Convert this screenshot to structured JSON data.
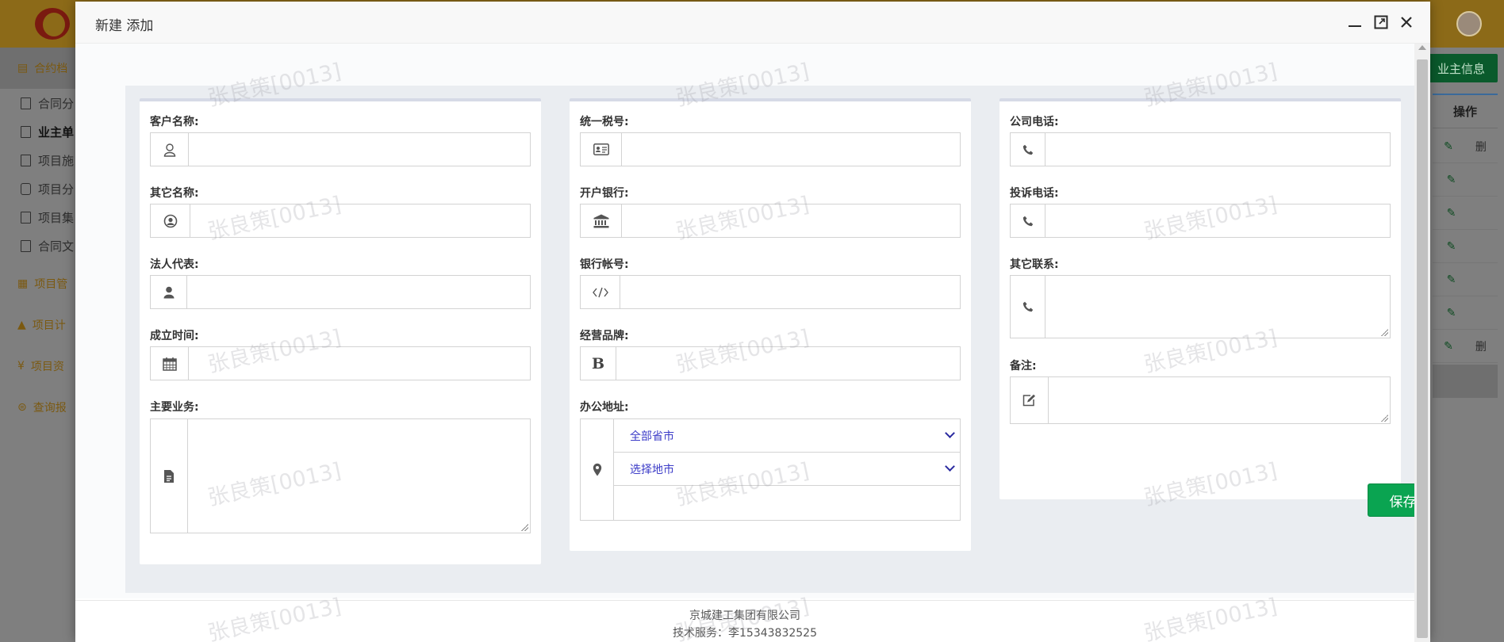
{
  "background": {
    "sidebar": {
      "groups": [
        "合约档",
        "项目管",
        "项目计",
        "项目资",
        "查询报"
      ],
      "items": [
        "合同分",
        "业主单",
        "项目施",
        "项目分",
        "项目集",
        "合同文"
      ]
    },
    "owner_button": "业主信息",
    "table": {
      "column": "操作",
      "row_actions": [
        "删",
        "",
        "",
        "",
        "",
        "",
        "删"
      ]
    }
  },
  "modal": {
    "title": "新建 添加",
    "fields": {
      "customer_name": {
        "label": "客户名称:",
        "value": ""
      },
      "other_name": {
        "label": "其它名称:",
        "value": ""
      },
      "legal_rep": {
        "label": "法人代表:",
        "value": ""
      },
      "established": {
        "label": "成立时间:",
        "value": ""
      },
      "main_business": {
        "label": "主要业务:",
        "value": ""
      },
      "tax_id": {
        "label": "统一税号:",
        "value": ""
      },
      "bank": {
        "label": "开户银行:",
        "value": ""
      },
      "bank_account": {
        "label": "银行帐号:",
        "value": ""
      },
      "brand": {
        "label": "经营品牌:",
        "value": ""
      },
      "office_address": {
        "label": "办公地址:",
        "province": "全部省市",
        "city": "选择地市",
        "detail": ""
      },
      "company_phone": {
        "label": "公司电话:",
        "value": ""
      },
      "complaint_phone": {
        "label": "投诉电话:",
        "value": ""
      },
      "other_contact": {
        "label": "其它联系:",
        "value": ""
      },
      "remark": {
        "label": "备注:",
        "value": ""
      }
    },
    "save_label": "保存添加",
    "footer": {
      "company": "京城建工集团有限公司",
      "support": "技术服务：李15343832525"
    },
    "watermark": "张良策[0013]"
  },
  "colors": {
    "accent_green": "#0aa451",
    "topbar": "#8c6a18",
    "select_text": "#3c3cc8"
  }
}
